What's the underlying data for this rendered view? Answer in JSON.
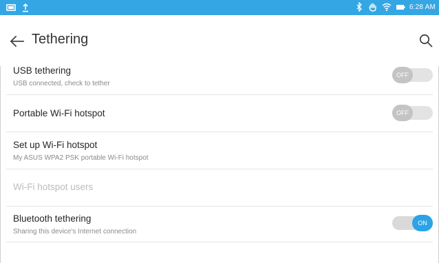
{
  "status_bar": {
    "time": "6:28 AM",
    "left_icons": [
      "screen-icon",
      "upload-icon"
    ],
    "right_icons": [
      "bluetooth-icon",
      "hand-icon",
      "wifi-icon",
      "battery-icon"
    ],
    "accent_color": "#35a6e4"
  },
  "app_bar": {
    "title": "Tethering",
    "back_icon": "arrow-left-icon",
    "search_icon": "search-icon"
  },
  "settings": [
    {
      "id": "usb",
      "title": "USB tethering",
      "subtitle": "USB connected, check to tether",
      "toggle": "OFF",
      "enabled": true
    },
    {
      "id": "hotspot",
      "title": "Portable Wi-Fi hotspot",
      "subtitle": "",
      "toggle": "OFF",
      "enabled": true
    },
    {
      "id": "setup",
      "title": "Set up Wi-Fi hotspot",
      "subtitle": "My ASUS WPA2 PSK portable Wi-Fi hotspot",
      "enabled": true
    },
    {
      "id": "users",
      "title": "Wi-Fi hotspot users",
      "subtitle": "",
      "enabled": false
    },
    {
      "id": "bluetooth",
      "title": "Bluetooth tethering",
      "subtitle": "Sharing this device's Internet connection",
      "toggle": "ON",
      "enabled": true
    }
  ]
}
